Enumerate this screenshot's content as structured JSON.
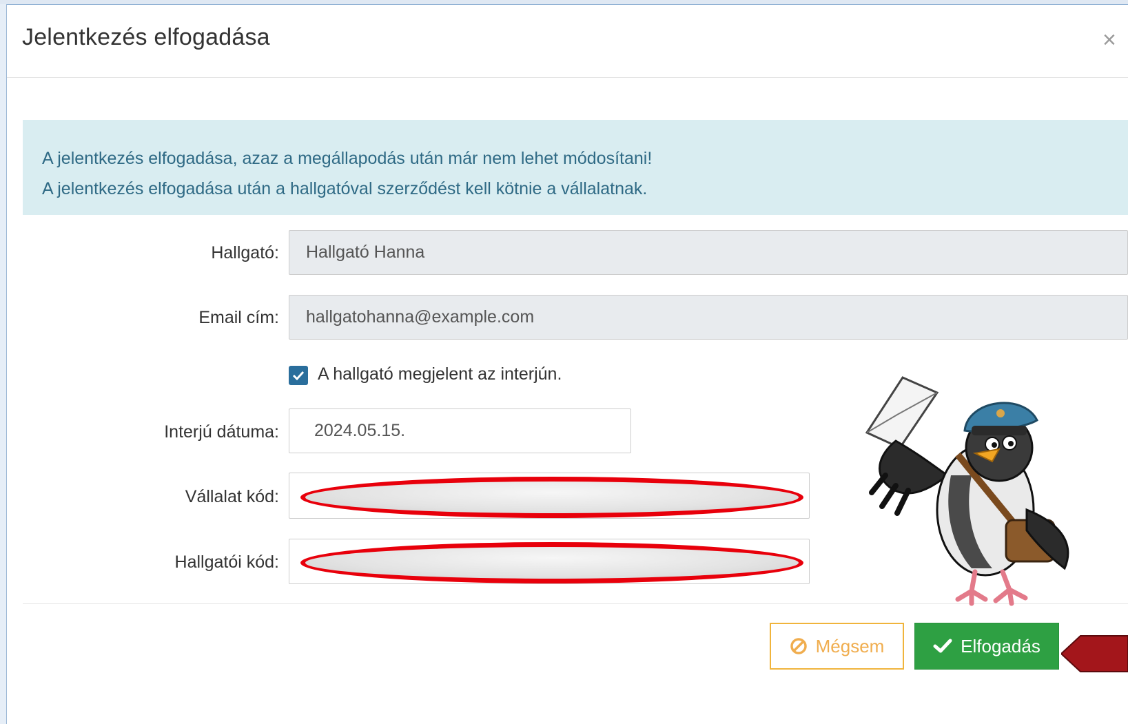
{
  "modal": {
    "title": "Jelentkezés elfogadása",
    "close": "×"
  },
  "alert": {
    "line1": "A jelentkezés elfogadása, azaz a megállapodás után már nem lehet módosítani!",
    "line2": "A jelentkezés elfogadása után a hallgatóval szerződést kell kötnie a vállalatnak."
  },
  "form": {
    "student_label": "Hallgató:",
    "student_value": "Hallgató Hanna",
    "email_label": "Email cím:",
    "email_value": "hallgatohanna@example.com",
    "attended_checked": true,
    "attended_label": "A hallgató megjelent az interjún.",
    "date_label": "Interjú dátuma:",
    "date_value": "2024.05.15.",
    "company_code_label": "Vállalat kód:",
    "student_code_label": "Hallgatói kód:"
  },
  "buttons": {
    "cancel": "Mégsem",
    "accept": "Elfogadás"
  },
  "colors": {
    "alert_bg": "#d9edf1",
    "alert_text": "#2f6a85",
    "accept": "#2ea043",
    "cancel": "#f0ad4e",
    "redaction": "#e8000b",
    "checkbox": "#2a6e9c"
  }
}
